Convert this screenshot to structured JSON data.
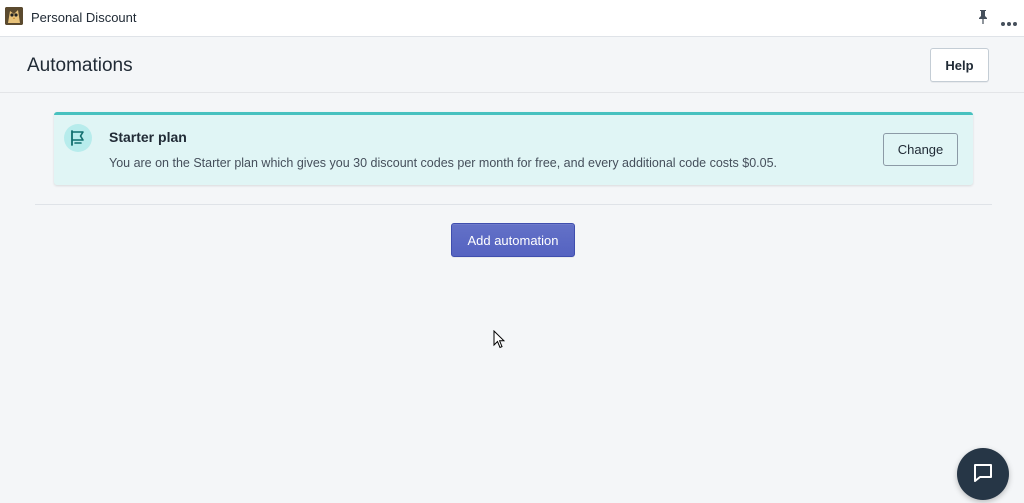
{
  "app": {
    "name": "Personal Discount",
    "logo_icon": "owl-logo-icon"
  },
  "titlebar": {
    "pin_icon": "pin-icon",
    "more_icon": "more-icon"
  },
  "header": {
    "title": "Automations",
    "help_label": "Help"
  },
  "banner": {
    "icon": "flag-icon",
    "title": "Starter plan",
    "text": "You are on the Starter plan which gives you 30 discount codes per month for free, and every additional code costs $0.05.",
    "change_label": "Change",
    "accent_color": "#47c1bf",
    "background_color": "#e0f5f5"
  },
  "main": {
    "add_label": "Add automation",
    "button_color": "#5c6ac4"
  },
  "chat": {
    "icon": "chat-icon",
    "color": "#263646"
  }
}
